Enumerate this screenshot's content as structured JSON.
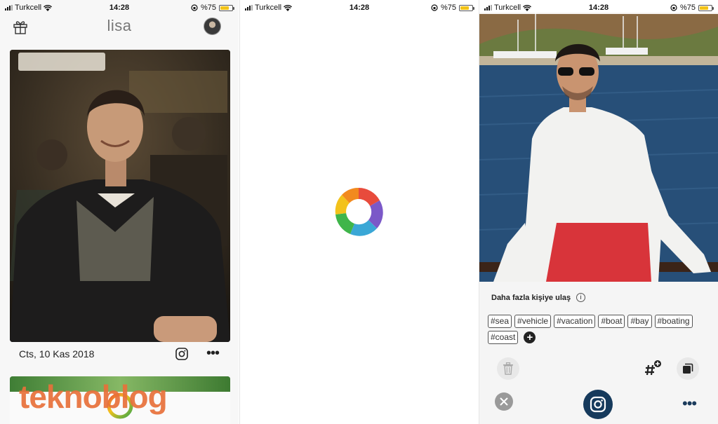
{
  "status_bar": {
    "carrier": "Turkcell",
    "time": "14:28",
    "battery": "%75",
    "battery_level": 0.75
  },
  "feed_screen": {
    "title": "lisa",
    "icons": {
      "gift": "gift-icon",
      "avatar": "profile-avatar"
    },
    "post": {
      "date": "Cts, 10 Kas 2018",
      "instagram_icon": "instagram-icon",
      "more_label": "•••"
    }
  },
  "loading_screen": {
    "spinner": "rainbow-loading-ring-icon"
  },
  "detail_screen": {
    "reach_label": "Daha fazla kişiye ulaş",
    "info_icon": "i",
    "tags": [
      "#sea",
      "#vehicle",
      "#vacation",
      "#boat",
      "#bay",
      "#boating",
      "#coast"
    ],
    "add_tag_label": "+",
    "toolbar": {
      "delete_icon": "trash-icon",
      "hashtag_add_icon": "hashtag-plus-icon",
      "copy_icon": "copy-icon"
    },
    "bottom_bar": {
      "close_icon": "close-icon",
      "share_icon": "instagram-icon",
      "more_label": "•••"
    }
  },
  "watermark": "teknoblog",
  "colors": {
    "accent_navy": "#163a5c",
    "watermark_orange": "#e8713a",
    "battery_yellow": "#f2c318"
  }
}
